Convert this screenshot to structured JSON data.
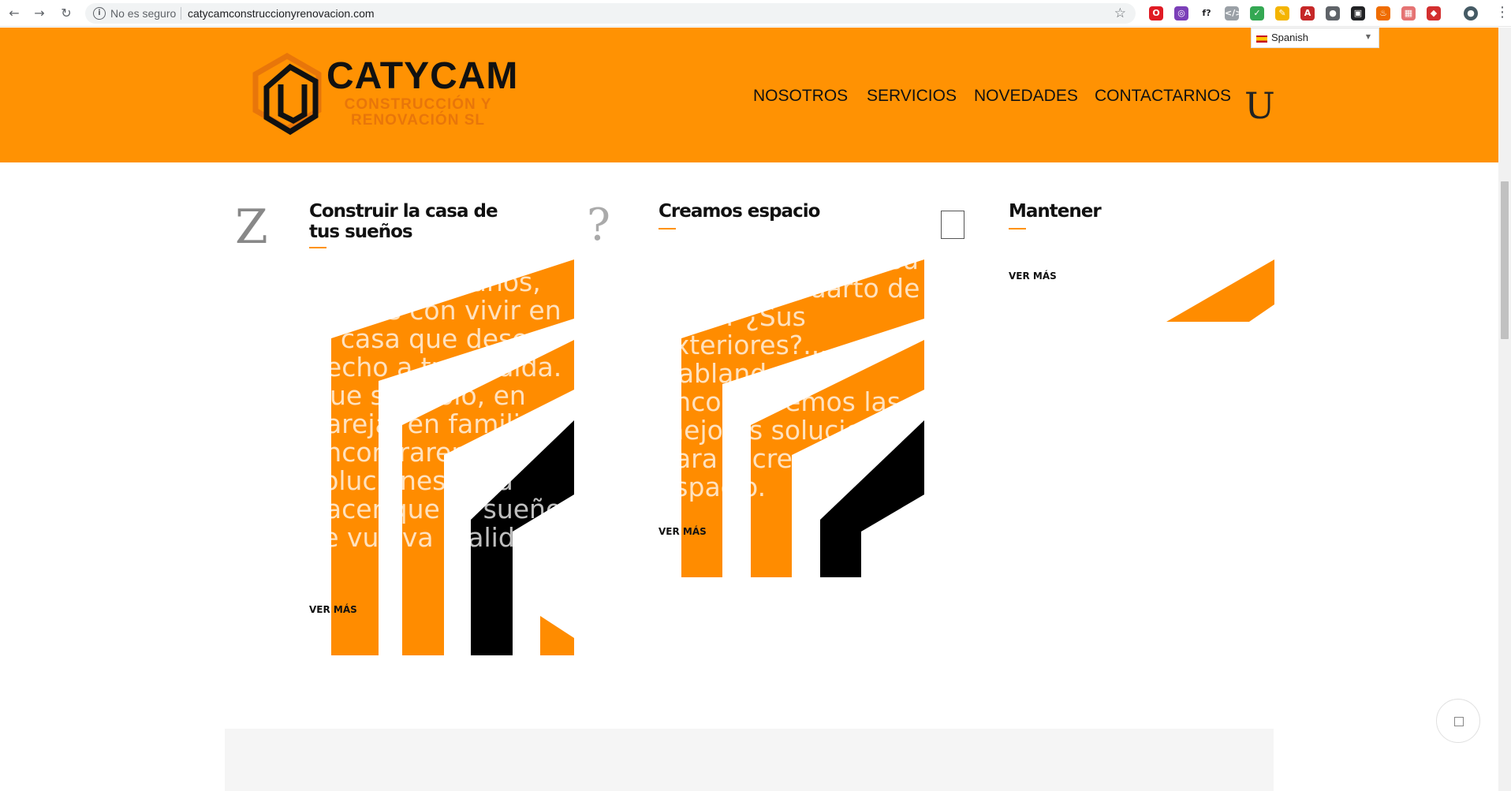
{
  "browser": {
    "security_label": "No es seguro",
    "url": "catycamconstruccionyrenovacion.com",
    "extensions": [
      {
        "name": "opera-icon",
        "color": "#e01b24",
        "glyph": "O"
      },
      {
        "name": "instagram-icon",
        "color": "#7b3fb8",
        "glyph": "◎"
      },
      {
        "name": "font-icon",
        "color": "#ffffff",
        "glyph": "f?"
      },
      {
        "name": "code-icon",
        "color": "#9aa0a6",
        "glyph": "</>"
      },
      {
        "name": "check-icon",
        "color": "#34a853",
        "glyph": "✓"
      },
      {
        "name": "edit-icon",
        "color": "#f4b400",
        "glyph": "✎"
      },
      {
        "name": "pdf-icon",
        "color": "#c62828",
        "glyph": "A"
      },
      {
        "name": "people-icon",
        "color": "#5f6368",
        "glyph": "●"
      },
      {
        "name": "cast-icon",
        "color": "#202124",
        "glyph": "▣"
      },
      {
        "name": "fire-icon",
        "color": "#ef6c00",
        "glyph": "♨"
      },
      {
        "name": "image-icon",
        "color": "#e57373",
        "glyph": "▦"
      },
      {
        "name": "shield-icon",
        "color": "#d32f2f",
        "glyph": "◆"
      },
      {
        "name": "avatar-icon",
        "color": "#455a64",
        "glyph": "●"
      }
    ]
  },
  "header": {
    "logo_name": "CATYCAM",
    "logo_sub_line1": "CONSTRUCCIÓN Y",
    "logo_sub_line2": "RENOVACIÓN SL",
    "nav": [
      "NOSOTROS",
      "SERVICIOS",
      "NOVEDADES",
      "CONTACTARNOS"
    ],
    "menu_glyph": "U",
    "language": "Spanish"
  },
  "services": [
    {
      "icon_glyph": "Z",
      "title": "Construir la casa de tus sueños",
      "description": "Desde hace años, sueñas con vivir en la casa que deseas hecho a tu medida. Que sea solo, en pareja, en familia… encontraremos soluciones para hacer que tu sueño se vuelva realidad.",
      "more_label": "VER MÁS"
    },
    {
      "icon_glyph": "?",
      "title": "Creamos espacio",
      "description": "¿Quiere reformar su casa? ¿Su cuarto de baño? ¿Sus exteriores?... Hablando encontraremos las mejores soluciones para recrear su espacio.",
      "more_label": "VER MÁS"
    },
    {
      "icon_glyph": "",
      "title": "Mantener",
      "description": "",
      "more_label": "VER MÁS"
    }
  ],
  "colors": {
    "brand_orange": "#ff9203",
    "graphic_orange": "#ff8c00",
    "black": "#000000"
  }
}
